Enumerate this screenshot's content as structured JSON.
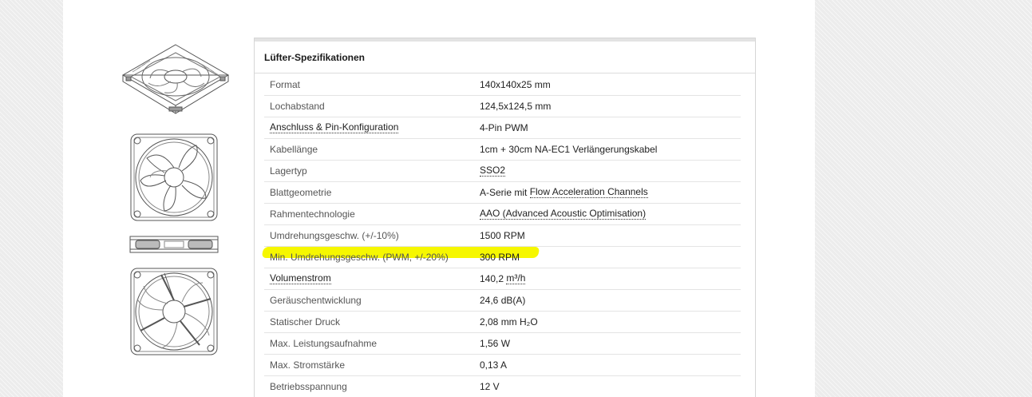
{
  "spec_panel": {
    "title": "Lüfter-Spezifikationen",
    "rows": [
      {
        "label": "Format",
        "value": "140x140x25 mm"
      },
      {
        "label": "Lochabstand",
        "value": "124,5x124,5 mm"
      },
      {
        "label": "Anschluss & Pin-Konfiguration",
        "value": "4-Pin PWM"
      },
      {
        "label": "Kabellänge",
        "value": "1cm + 30cm NA-EC1 Verlängerungskabel"
      },
      {
        "label": "Lagertyp",
        "value": "SSO2"
      },
      {
        "label": "Blattgeometrie",
        "value_prefix": "A-Serie mit ",
        "value_link": "Flow Acceleration Channels"
      },
      {
        "label": "Rahmentechnologie",
        "value": "AAO (Advanced Acoustic Optimisation)"
      },
      {
        "label": "Umdrehungsgeschw. (+/-10%)",
        "value": "1500 RPM"
      },
      {
        "label": "Min. Umdrehungsgeschw. (PWM, +/-20%)",
        "value": "300 RPM"
      },
      {
        "label": "Volumenstrom",
        "value_prefix": "140,2 ",
        "value_link": "m³/h"
      },
      {
        "label": "Geräuschentwicklung",
        "value": "24,6 dB(A)"
      },
      {
        "label": "Statischer Druck",
        "value": "2,08 mm H₂O"
      },
      {
        "label": "Max. Leistungsaufnahme",
        "value": "1,56 W"
      },
      {
        "label": "Max. Stromstärke",
        "value": "0,13 A"
      },
      {
        "label": "Betriebsspannung",
        "value": "12 V"
      }
    ]
  },
  "highlight_color": "#f6f700",
  "thumbnails": [
    {
      "icon": "fan-isometric-drawing"
    },
    {
      "icon": "fan-front-drawing"
    },
    {
      "icon": "fan-side-drawing"
    },
    {
      "icon": "fan-back-drawing"
    }
  ]
}
